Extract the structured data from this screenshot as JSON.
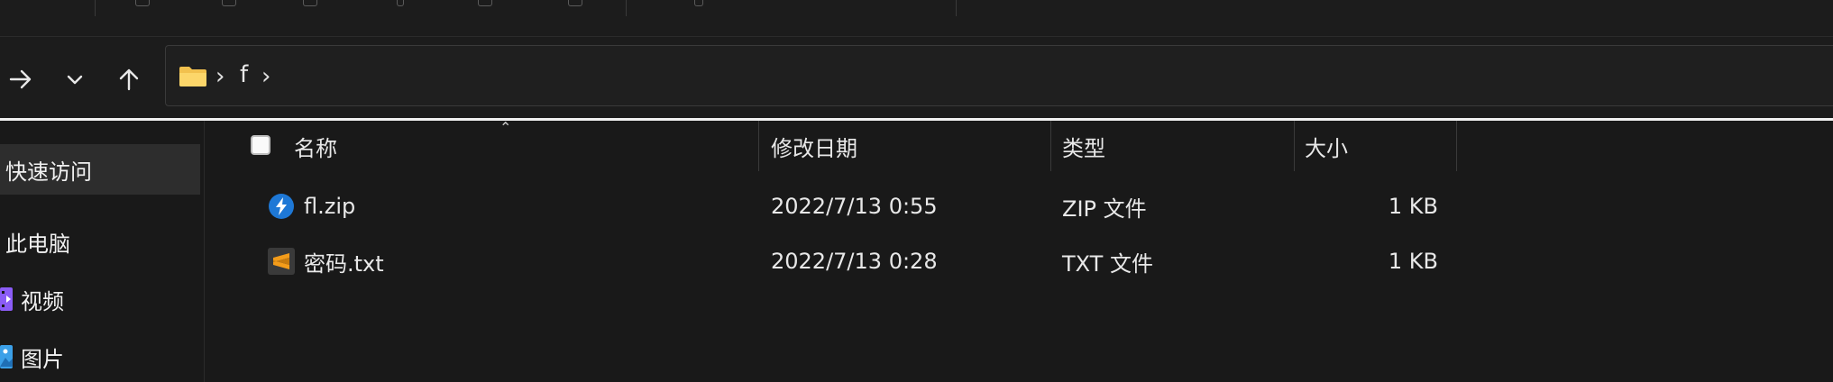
{
  "nav": {
    "forward_icon": "arrow-right-icon",
    "recent_icon": "chevron-down-icon",
    "up_icon": "arrow-up-icon"
  },
  "address": {
    "folder_icon": "folder-icon",
    "chevron_1": "›",
    "segment": "f",
    "chevron_2": "›"
  },
  "sidebar": {
    "items": [
      {
        "label": "快速访问",
        "active": true
      },
      {
        "label": "此电脑"
      },
      {
        "label": "视频",
        "icon": "video-folder-icon",
        "color": "#8b5cf6"
      },
      {
        "label": "图片",
        "icon": "pictures-folder-icon",
        "color": "#3ba0e8"
      }
    ]
  },
  "columns": {
    "name": "名称",
    "modified": "修改日期",
    "type": "类型",
    "size": "大小"
  },
  "files": [
    {
      "name": "fl.zip",
      "modified": "2022/7/13 0:55",
      "type": "ZIP 文件",
      "size": "1 KB",
      "icon": "bandizip-icon",
      "color": "#1e78d6"
    },
    {
      "name": "密码.txt",
      "modified": "2022/7/13 0:28",
      "type": "TXT 文件",
      "size": "1 KB",
      "icon": "sublime-text-icon",
      "color": "#f39c1a"
    }
  ]
}
